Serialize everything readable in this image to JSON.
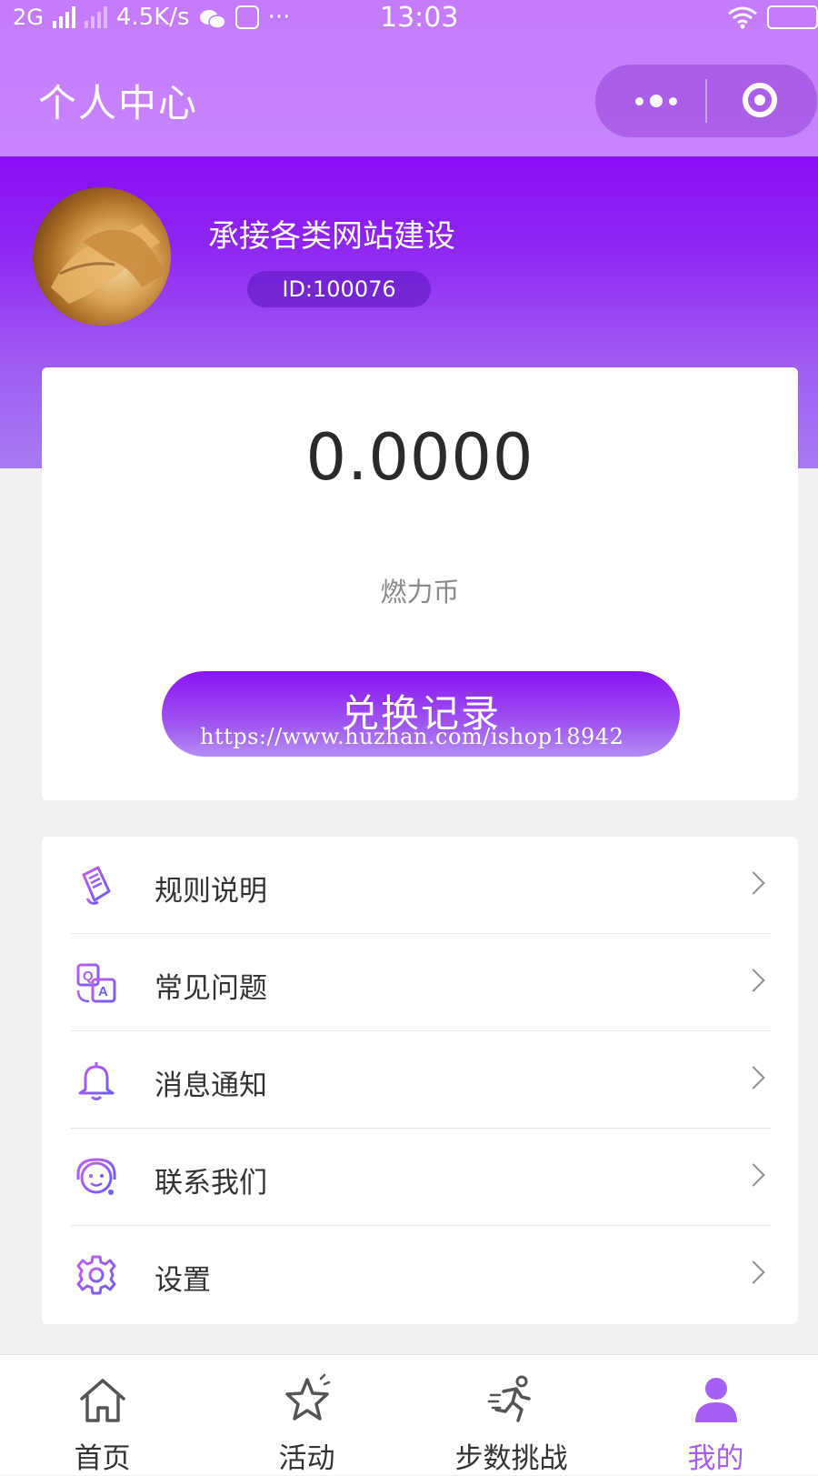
{
  "status_bar": {
    "network": "2G",
    "speed": "4.5K/s",
    "more": "···",
    "time": "13:03"
  },
  "nav": {
    "title": "个人中心"
  },
  "profile": {
    "username": "承接各类网站建设",
    "id_label": "ID:100076"
  },
  "balance_card": {
    "amount": "0.0000",
    "unit_label": "燃力币",
    "exchange_button": "兑换记录"
  },
  "watermark": "https://www.huzhan.com/ishop18942",
  "menu": [
    {
      "label": "规则说明",
      "icon": "rules-document-icon"
    },
    {
      "label": "常见问题",
      "icon": "qa-icon"
    },
    {
      "label": "消息通知",
      "icon": "bell-icon"
    },
    {
      "label": "联系我们",
      "icon": "customer-service-icon"
    },
    {
      "label": "设置",
      "icon": "gear-icon"
    }
  ],
  "tabbar": [
    {
      "label": "首页",
      "icon": "home-icon",
      "active": false
    },
    {
      "label": "活动",
      "icon": "star-icon",
      "active": false
    },
    {
      "label": "步数挑战",
      "icon": "running-icon",
      "active": false
    },
    {
      "label": "我的",
      "icon": "user-icon",
      "active": true
    }
  ],
  "colors": {
    "accent": "#a55ff5",
    "header_gradient_top": "#8a10f5",
    "nav_bar": "#c57fff"
  }
}
